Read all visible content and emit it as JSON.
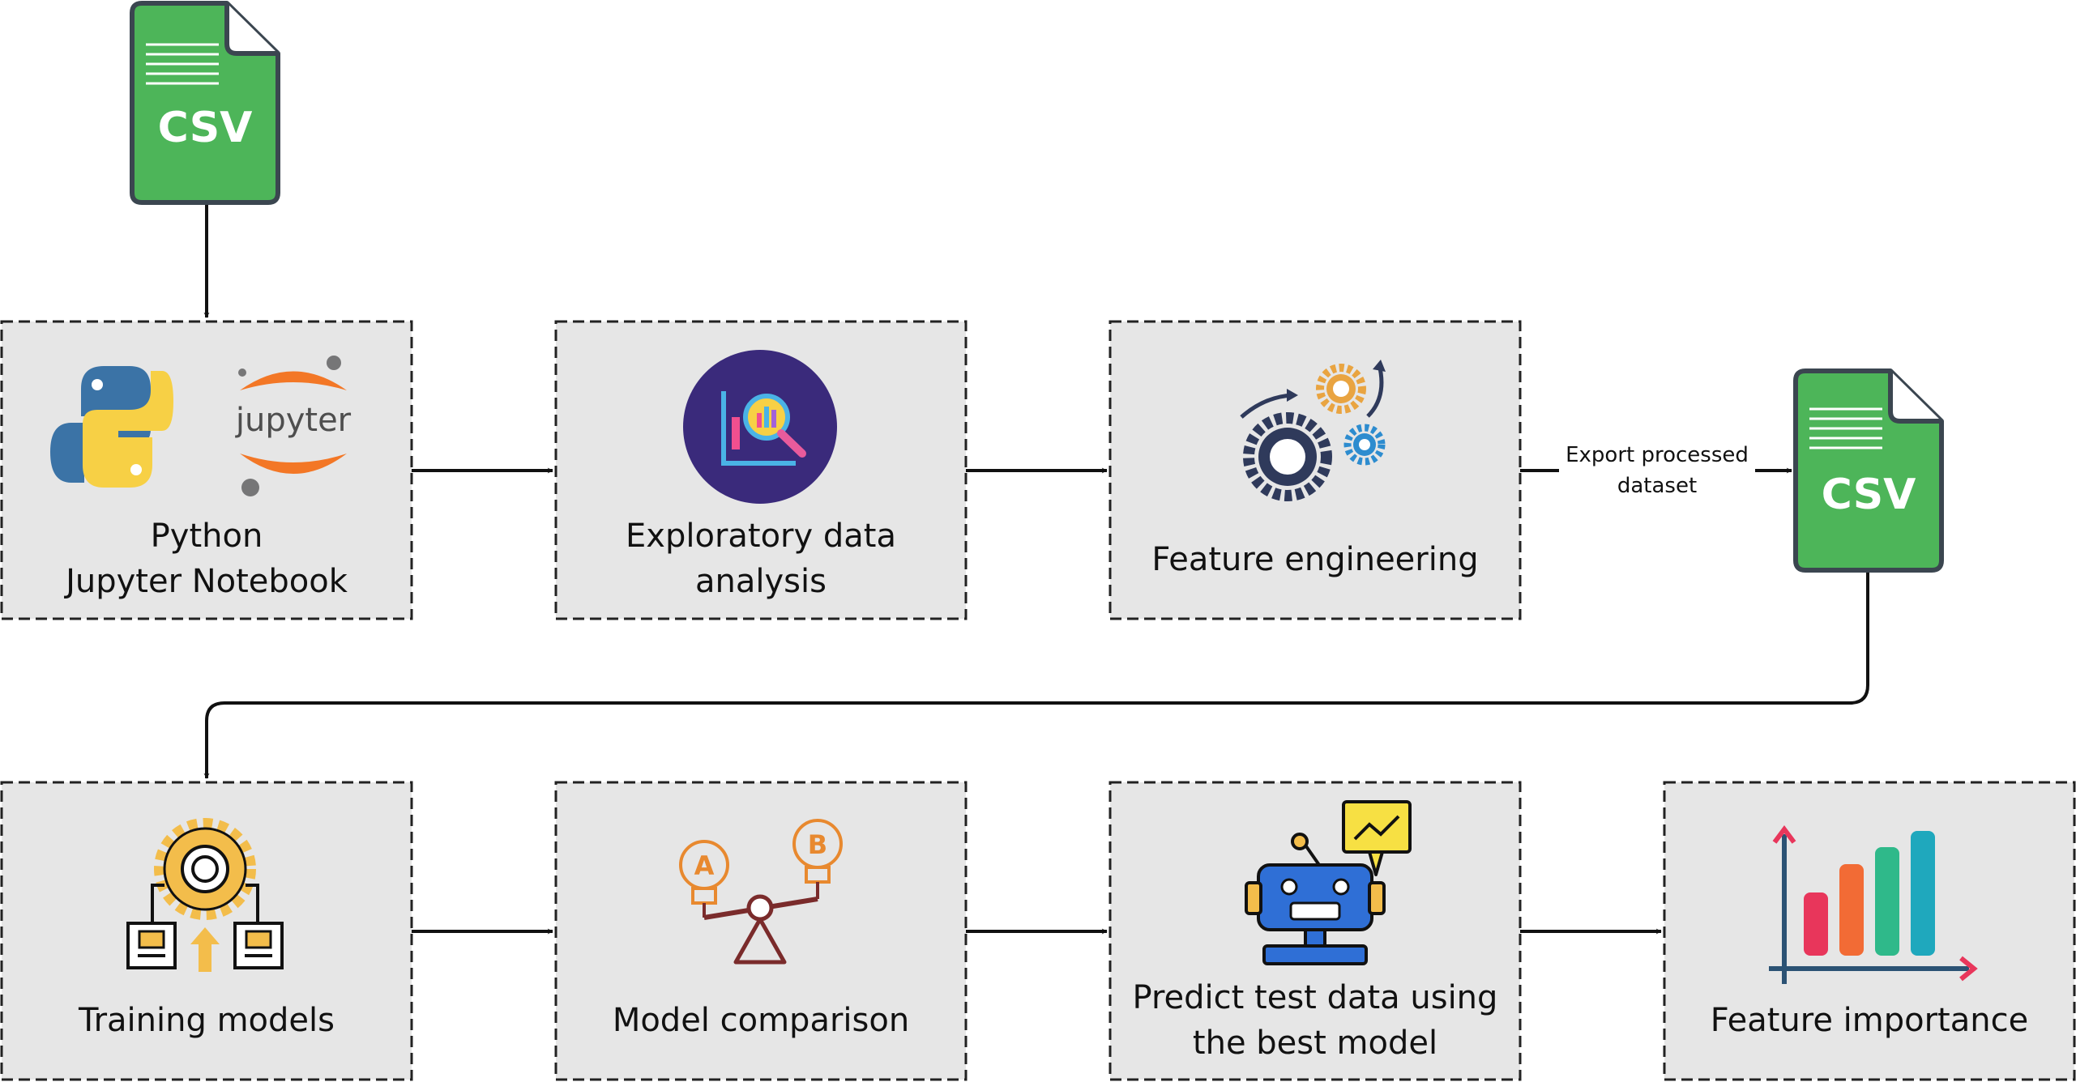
{
  "nodes": {
    "csv_input": {
      "icon_text": "CSV",
      "icon": "csv-file-icon",
      "color": "#4db559"
    },
    "python_jupyter": {
      "line1": "Python",
      "line2": "Jupyter Notebook",
      "icon_text": "jupyter",
      "icons": [
        "python-logo-icon",
        "jupyter-logo-icon"
      ]
    },
    "eda": {
      "line1": "Exploratory data",
      "line2": "analysis",
      "icon": "chart-magnifier-icon"
    },
    "feature_eng": {
      "label": "Feature engineering",
      "icon": "gears-icon"
    },
    "csv_output": {
      "icon_text": "CSV",
      "icon": "csv-file-icon"
    },
    "training": {
      "label": "Training models",
      "icon": "training-gear-icon"
    },
    "comparison": {
      "label": "Model comparison",
      "icon": "ab-balance-icon",
      "icon_text_a": "A",
      "icon_text_b": "B"
    },
    "predict": {
      "line1": "Predict test data using",
      "line2": "the best model",
      "icon": "robot-chart-icon"
    },
    "importance": {
      "label": "Feature importance",
      "icon": "bar-chart-icon"
    }
  },
  "edges": {
    "export": {
      "line1": "Export processed",
      "line2": "dataset"
    }
  },
  "colors": {
    "box_fill": "#e6e6e6",
    "box_border": "#222222",
    "csv_green": "#4db559",
    "csv_outline": "#3b4650",
    "arrow": "#111111"
  }
}
